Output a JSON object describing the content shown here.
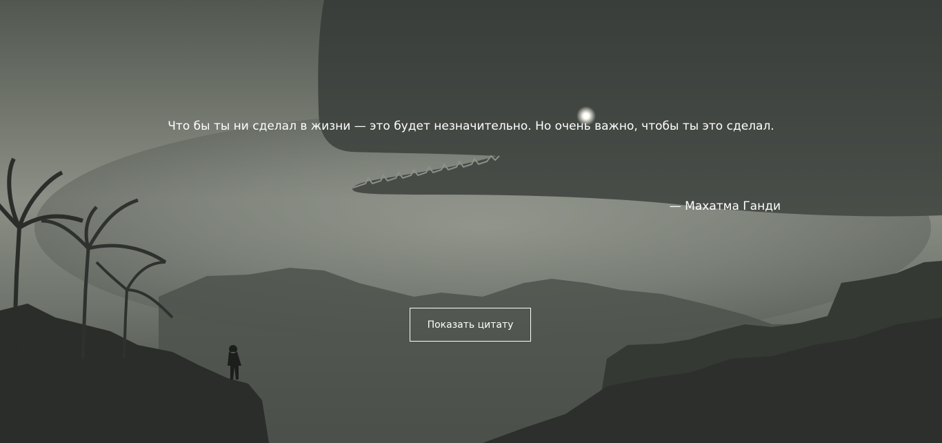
{
  "quote": {
    "text": "Что бы ты ни сделал в жизни — это будет незначительно. Но очень важно, чтобы ты это сделал.",
    "author": "— Махатма Ганди"
  },
  "actions": {
    "show_quote_label": "Показать цитату"
  },
  "colors": {
    "text": "#ffffff",
    "fog": "#8a8f87",
    "whale": "#3e423e",
    "mountains": "#3a3e39",
    "foreground": "#2a2d29"
  }
}
